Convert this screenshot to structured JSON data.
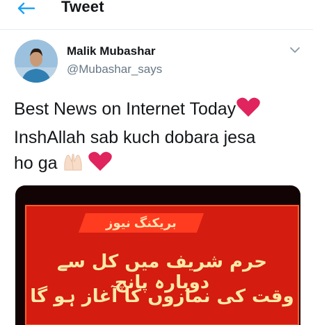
{
  "header": {
    "title": "Tweet",
    "back_icon": "arrow-left-icon"
  },
  "author": {
    "name": "Malik Mubashar",
    "handle": "@Mubashar_says"
  },
  "tweet": {
    "line1": "Best News on Internet Today",
    "line2": "InshAllah sab kuch dobara jesa",
    "line3": "ho ga",
    "emojis": [
      "red-heart-icon",
      "raised-hands-icon",
      "red-heart-icon"
    ]
  },
  "media": {
    "channel_label": "بریکنگ نیوز",
    "headline_line1": "حرم شریف میں کل سے دوبارہ پانچ",
    "headline_line2": "وقت کی نمازوں کا آغاز ہو گا"
  },
  "colors": {
    "accent": "#1da1f2",
    "text": "#14171a",
    "muted": "#657786",
    "heart": "#e0245e",
    "banner": "#d41c10"
  }
}
